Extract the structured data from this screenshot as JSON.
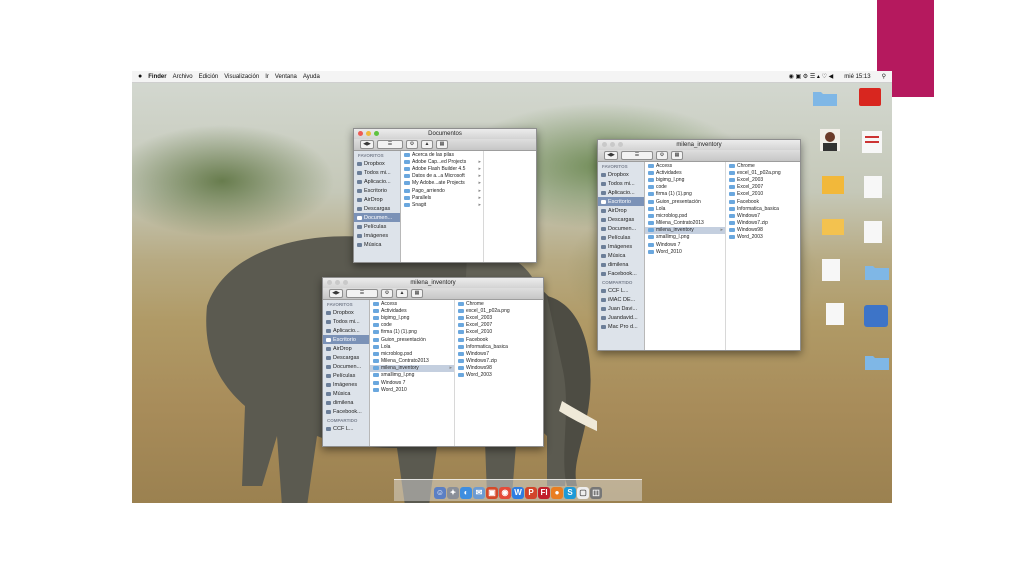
{
  "menubar": {
    "app_name": "Finder",
    "menus": [
      "Archivo",
      "Edición",
      "Visualización",
      "Ir",
      "Ventana",
      "Ayuda"
    ],
    "clock": "mié 15:13"
  },
  "sidebar": {
    "favorites_header": "FAVORITOS",
    "shared_header": "COMPARTIDO",
    "items": [
      "Dropbox",
      "Todos mi...",
      "Aplicacio...",
      "Escritorio",
      "AirDrop",
      "Descargas",
      "Documen...",
      "Películas",
      "Imágenes",
      "Música",
      "dimilena",
      "Facebook..."
    ],
    "documentos_items": [
      "Dropbox",
      "Todos mi...",
      "Aplicacio...",
      "Escritorio",
      "AirDrop",
      "Descargas",
      "Documen...",
      "Películas",
      "Imágenes",
      "Música"
    ],
    "shared_items": [
      "CCF L...",
      "iMAC DE...",
      "Juan Davi...",
      "Juandavid...",
      "Mac Pro d..."
    ]
  },
  "win_documentos": {
    "title": "Documentos",
    "files": [
      "Acerca de las pilas",
      "Adobe Cap...ed Projects",
      "Adobe Flash Builder 4.5",
      "Datos de a...a Microsoft",
      "My Adobe...ate Projects",
      "Pago_arriendo",
      "Parallels",
      "Snagit"
    ]
  },
  "win_milena_a": {
    "title": "milena_inventory",
    "col1": [
      "Access",
      "Actividades",
      "bigimg_l.png",
      "code",
      "firma (1) (1).png",
      "Guion_presentación",
      "Lola",
      "microblog.psd",
      "Milena_Contrato2013",
      "milena_inventory",
      "smallimg_l.png",
      "Windows 7",
      "Word_2010"
    ],
    "col2": [
      "Chrome",
      "excel_01_p02a.png",
      "Excel_2003",
      "Excel_2007",
      "Excel_2010",
      "Facebook",
      "Informatica_basica",
      "Windows7",
      "Windows7.zip",
      "Windows98",
      "Word_2003"
    ]
  },
  "win_milena_b": {
    "title": "milena_inventory",
    "col1": [
      "Access",
      "Actividades",
      "bigimg_l.png",
      "code",
      "firma (1) (1).png",
      "Guion_presentación",
      "Lola",
      "microblog.psd",
      "Milena_Contrato2013",
      "milena_inventory",
      "smallimg_l.png",
      "Windows 7",
      "Word_2010"
    ],
    "col2": [
      "Chrome",
      "excel_01_p02a.png",
      "Excel_2003",
      "Excel_2007",
      "Excel_2010",
      "Facebook",
      "Informatica_basica",
      "Windows7",
      "Windows7.zip",
      "Windows98",
      "Word_2003"
    ]
  },
  "colors": {
    "accent": "#b5195e",
    "sidebar_selected": "#7b92b7",
    "folder_blue": "#6aa7de"
  }
}
